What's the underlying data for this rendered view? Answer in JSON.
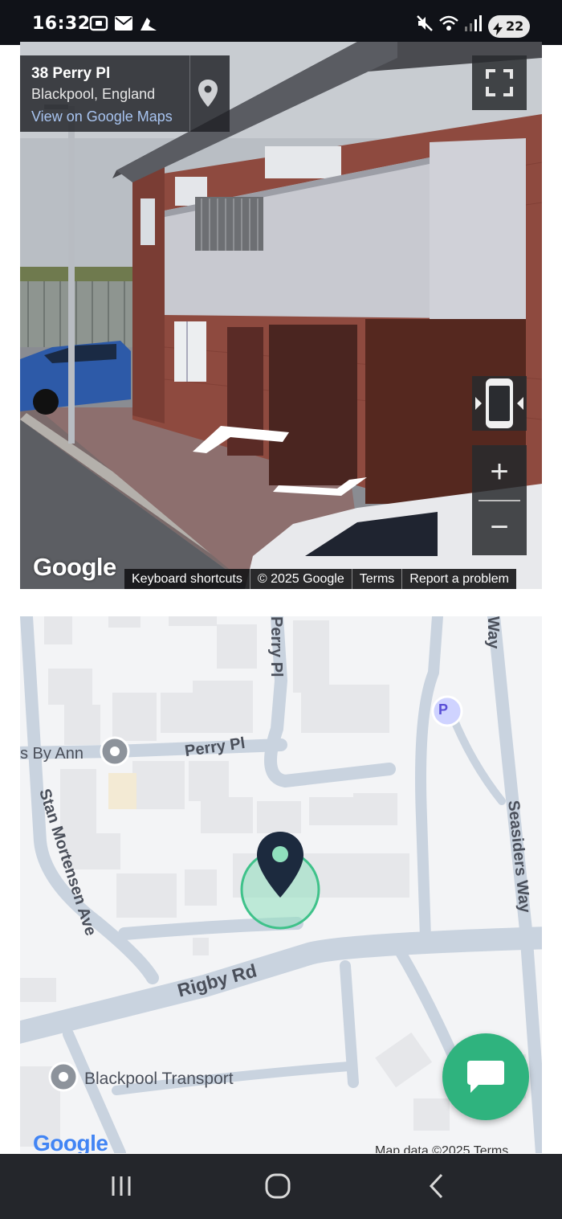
{
  "status_bar": {
    "time": "16:32",
    "left_icons": [
      "screenshot-icon",
      "mail-icon",
      "runner-icon"
    ],
    "right_icons": [
      "mute-icon",
      "wifi-icon",
      "signal-icon"
    ],
    "battery_level": "22"
  },
  "street_view": {
    "address_title": "38 Perry Pl",
    "address_subtitle": "Blackpool, England",
    "view_link": "View on Google Maps",
    "logo": "Google",
    "footer": {
      "shortcuts": "Keyboard shortcuts",
      "copyright": "© 2025 Google",
      "terms": "Terms",
      "report": "Report a problem"
    },
    "zoom_in": "+",
    "zoom_out": "−"
  },
  "map": {
    "labels": {
      "perry_pl_vertical": "Perry Pl",
      "perry_pl": "Perry Pl",
      "by_ann": "s By Ann",
      "stan_mortensen": "Stan Mortensen Ave",
      "seasiders": "Seasiders Way",
      "rigby": "Rigby Rd",
      "way_top": "Way",
      "transport": "Blackpool Transport",
      "parking": "P"
    },
    "logo": "Google",
    "footer": "Map data ©2025    Terms"
  },
  "colors": {
    "accent_green": "#2fb37e",
    "marker_navy": "#1c2a3e",
    "road": "#c9d3df",
    "parking": "#5a4fd6"
  }
}
